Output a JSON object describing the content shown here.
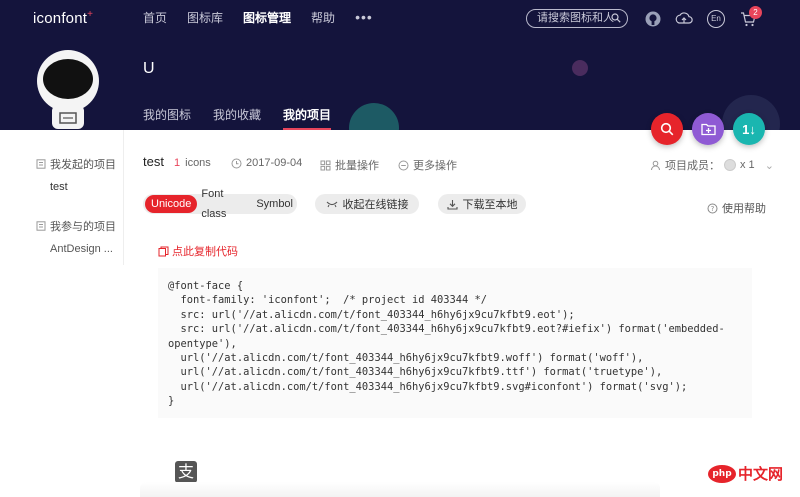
{
  "header": {
    "logo": "iconfont",
    "logo_mark": "+",
    "nav": [
      {
        "label": "首页"
      },
      {
        "label": "图标库"
      },
      {
        "label": "图标管理",
        "active": true
      },
      {
        "label": "帮助"
      }
    ],
    "more": "•••",
    "search_placeholder": "请搜索图标和人",
    "icons": [
      "github-icon",
      "upload-icon",
      "language-icon",
      "cart-icon"
    ],
    "lang": "En",
    "cart_count": "2",
    "username": "U",
    "subnav": [
      {
        "label": "我的图标"
      },
      {
        "label": "我的收藏"
      },
      {
        "label": "我的项目",
        "active": true
      }
    ],
    "colors": {
      "bg": "#14143c",
      "accent": "#e8455b"
    }
  },
  "fabs": [
    {
      "name": "search-icon",
      "color": "#e6242b"
    },
    {
      "name": "add-folder-icon",
      "color": "#8f5ad4"
    },
    {
      "name": "sort-icon",
      "label": "1↓",
      "color": "#1ab6b0"
    }
  ],
  "sidebar": {
    "groups": [
      {
        "title": "我发起的项目",
        "items": [
          "test"
        ]
      },
      {
        "title": "我参与的项目",
        "items": [
          "AntDesign ..."
        ]
      }
    ]
  },
  "project": {
    "name": "test",
    "icon_count": "1",
    "icon_unit": "icons",
    "date": "2017-09-04",
    "batch": "批量操作",
    "more_ops": "更多操作",
    "members_label": "项目成员：",
    "members_count": "x 1"
  },
  "tabs": [
    {
      "label": "Unicode",
      "active": true
    },
    {
      "label": "Font class"
    },
    {
      "label": "Symbol"
    }
  ],
  "actions": {
    "collapse_link": "收起在线链接",
    "download": "下载至本地",
    "help": "使用帮助"
  },
  "code": {
    "copy_label": "点此复制代码",
    "text": "@font-face {\n  font-family: 'iconfont';  /* project id 403344 */\n  src: url('//at.alicdn.com/t/font_403344_h6hy6jx9cu7kfbt9.eot');\n  src: url('//at.alicdn.com/t/font_403344_h6hy6jx9cu7kfbt9.eot?#iefix') format('embedded-\nopentype'),\n  url('//at.alicdn.com/t/font_403344_h6hy6jx9cu7kfbt9.woff') format('woff'),\n  url('//at.alicdn.com/t/font_403344_h6hy6jx9cu7kfbt9.ttf') format('truetype'),\n  url('//at.alicdn.com/t/font_403344_h6hy6jx9cu7kfbt9.svg#iconfont') format('svg');\n}"
  },
  "footer": {
    "alipay_glyph": "支",
    "watermark_php": "php",
    "watermark_site": "中文网"
  }
}
